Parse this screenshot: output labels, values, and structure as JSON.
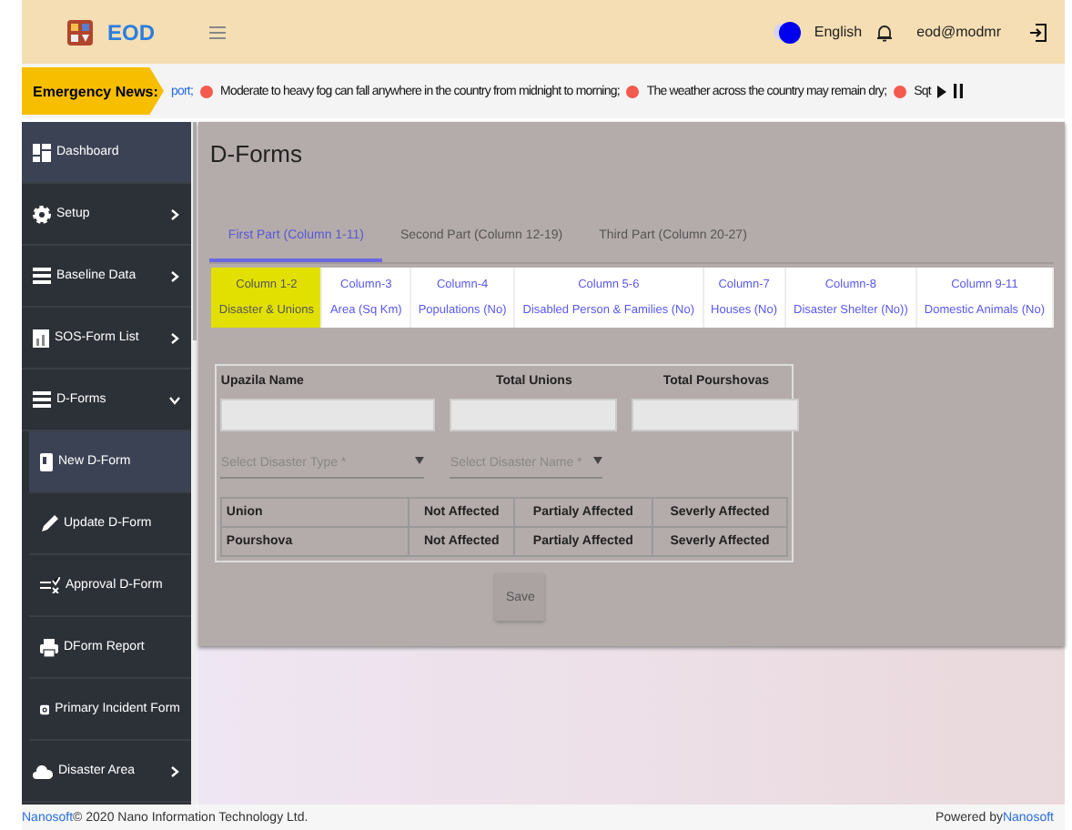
{
  "header": {
    "brand": "EOD",
    "dark_mode": {
      "on": true
    },
    "language": "English",
    "user": "eod@modmr"
  },
  "news": {
    "label": "Emergency News:",
    "lead": "port;",
    "items": [
      "Moderate to heavy fog can fall anywhere in the country from midnight to morning;",
      "The weather across the country may remain dry;",
      "Sqt"
    ]
  },
  "sidebar": {
    "items": [
      {
        "label": "Dashboard",
        "selected": true
      },
      {
        "label": "Setup",
        "selected": false,
        "expanded": false
      },
      {
        "label": "Baseline Data",
        "selected": false,
        "expanded": false
      },
      {
        "label": "SOS-Form List",
        "selected": false,
        "expanded": false
      },
      {
        "label": "D-Forms",
        "selected": false,
        "expanded": true,
        "children": [
          {
            "label": "New D-Form",
            "selected": true
          },
          {
            "label": "Update D-Form",
            "selected": false
          },
          {
            "label": "Approval D-Form",
            "selected": false
          },
          {
            "label": "DForm Report",
            "selected": false
          },
          {
            "label": "Primary Incident Form",
            "selected": false
          }
        ]
      },
      {
        "label": "Disaster Area",
        "selected": false,
        "expanded": false
      }
    ]
  },
  "page": {
    "title": "D-Forms",
    "tabs": [
      {
        "label": "First Part (Column 1-11)",
        "selected": true
      },
      {
        "label": "Second Part (Column 12-19)",
        "selected": false
      },
      {
        "label": "Third Part (Column 20-27)",
        "selected": false
      }
    ],
    "column_tabs": [
      {
        "label": "Column 1-2",
        "sub": "Disaster & Unions",
        "selected": true
      },
      {
        "label": "Column-3",
        "sub": "Area (Sq Km)",
        "selected": false
      },
      {
        "label": "Column-4",
        "sub": "Populations (No)",
        "selected": false
      },
      {
        "label": "Column 5-6",
        "sub": "Disabled Person & Families (No)",
        "selected": false
      },
      {
        "label": "Column-7",
        "sub": "Houses (No)",
        "selected": false
      },
      {
        "label": "Column-8",
        "sub": "Disaster Shelter (No))",
        "selected": false
      },
      {
        "label": "Column 9-11",
        "sub": "Domestic Animals (No)",
        "selected": false
      }
    ],
    "fields": [
      "Upazila Name",
      "Total Unions",
      "Total Pourshovas"
    ],
    "selects": [
      {
        "placeholder": "Select Disaster Type *"
      },
      {
        "placeholder": "Select Disaster Name *"
      }
    ],
    "table": {
      "rows": [
        [
          "Union",
          "Not Affected",
          "Partialy Affected",
          "Severly Affected"
        ],
        [
          "Pourshova",
          "Not Affected",
          "Partialy Affected",
          "Severly Affected"
        ]
      ]
    },
    "save": {
      "label": "Save",
      "disabled": true
    }
  },
  "footer": {
    "link": "Nanosoft",
    "copyright": "© 2020 Nano Information Technology Ltd.",
    "powered": "Powered by",
    "powered_link": "Nanosoft"
  }
}
